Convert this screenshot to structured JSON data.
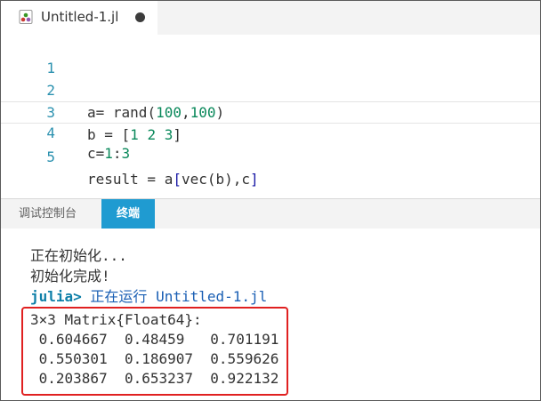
{
  "tab": {
    "title": "Untitled-1.jl",
    "file_icon": "julia-file-icon",
    "dirty_indicator": "unsaved-dot-icon"
  },
  "editor": {
    "lines": [
      {
        "number": "1",
        "code": ""
      },
      {
        "number": "2",
        "code": "a= rand(100,100)"
      },
      {
        "number": "3",
        "code": "b = [1 2 3]"
      },
      {
        "number": "4",
        "code": "c=1:3"
      },
      {
        "number": "5",
        "code": "result = a[vec(b),c]"
      }
    ],
    "current_line": 4
  },
  "panel": {
    "tabs": [
      {
        "label": "调试控制台",
        "active": false
      },
      {
        "label": "终端",
        "active": true
      }
    ]
  },
  "terminal": {
    "lines": [
      "正在初始化...",
      "初始化完成!"
    ],
    "prompt": "julia>",
    "run_message": " 正在运行 Untitled-1.jl",
    "matrix_header": "3×3 Matrix{Float64}:",
    "matrix_rows": [
      " 0.604667  0.48459   0.701191",
      " 0.550301  0.186907  0.559626",
      " 0.203867  0.653237  0.922132"
    ],
    "highlight_color": "#e02020"
  },
  "colors": {
    "line_number": "#2b91af",
    "number_literal": "#09885a",
    "active_tab": "#1f9bd1"
  }
}
